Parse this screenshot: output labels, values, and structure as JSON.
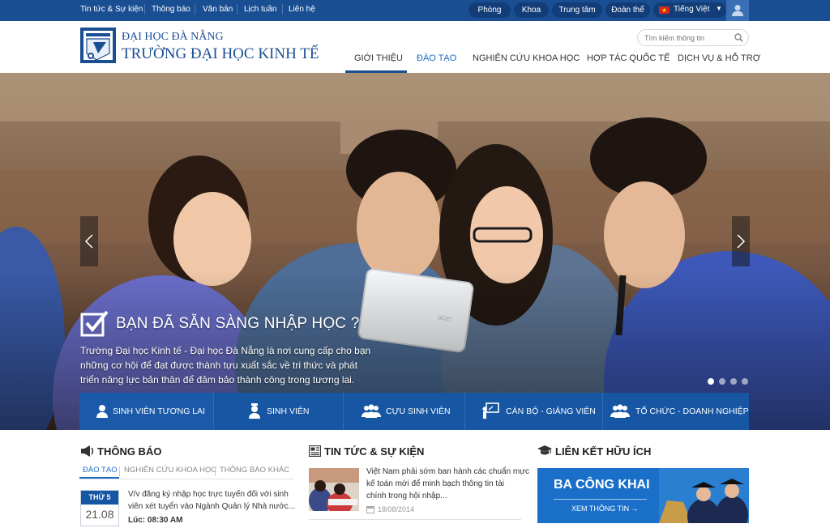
{
  "topbar": {
    "links": [
      "Tin tức & Sự kiện",
      "Thông báo",
      "Văn bản",
      "Lịch tuần",
      "Liên hệ"
    ],
    "pills": [
      "Phòng",
      "Khoa",
      "Trung tâm",
      "Đoàn thể"
    ],
    "language": "Tiếng Việt"
  },
  "header": {
    "university": "ĐẠI HỌC ĐÀ NẴNG",
    "school": "TRƯỜNG ĐẠI HỌC KINH TẾ",
    "search_placeholder": "Tìm kiếm thông tin",
    "nav": [
      "GIỚI THIỆU",
      "ĐÀO TẠO",
      "NGHIÊN CỨU KHOA HỌC",
      "HỢP TÁC QUỐC TẾ",
      "DỊCH VỤ & HỖ TRỢ"
    ]
  },
  "hero": {
    "heading": "BẠN ĐÃ SẴN SÀNG NHẬP HỌC ?",
    "text_lines": [
      "Trường Đại học Kinh tế - Đại học Đà Nẵng là nơi cung cấp cho bạn",
      "những cơ hội để đạt được thành tựu xuất sắc về tri thức và phát",
      "triển năng lực bản thân để đảm bảo thành công trong tương lai."
    ],
    "tablet_brand": "acer"
  },
  "tiles": [
    "SINH VIÊN TƯƠNG LAI",
    "SINH VIÊN",
    "CỰU SINH VIÊN",
    "CÁN BỘ - GIẢNG VIÊN",
    "TỔ CHỨC - DOANH NGHIỆP"
  ],
  "notices": {
    "title": "THÔNG BÁO",
    "tabs": [
      "ĐÀO TẠO",
      "NGHIÊN CỨU KHOA HỌC",
      "THÔNG BÁO KHÁC"
    ],
    "weekday": "THỨ 5",
    "date": "21.08",
    "text_lines": [
      "V/v đăng ký nhập học trực tuyến đối với sinh",
      "viên xét tuyển vào Ngành Quản lý Nhà nước..."
    ],
    "time": "Lúc: 08:30 AM"
  },
  "news": {
    "title": "TIN TỨC & SỰ KIỆN",
    "text_lines": [
      "Việt Nam phải sớm ban hành các chuẩn mực",
      "kế toán mới để minh bạch thông tin tài",
      "chính trong hội nhập..."
    ],
    "date": "18/08/2014"
  },
  "links": {
    "title": "LIÊN KẾT HỮU ÍCH",
    "banner_title": "BA CÔNG KHAI",
    "banner_link": "XEM THÔNG TIN →"
  },
  "colors": {
    "topbar": "#1a4e93",
    "pill": "#123d78",
    "brand_blue": "#1656a3",
    "nav_active": "#1a6bc6",
    "banner": "#1a70c8"
  },
  "icons": [
    "user-icon",
    "search-icon",
    "flag-vn-icon",
    "chevron-left-icon",
    "chevron-right-icon",
    "checkbox-icon",
    "megaphone-icon",
    "newspaper-icon",
    "graduation-cap-icon",
    "people-icon",
    "board-icon",
    "calendar-icon"
  ],
  "slider": {
    "dot_count": 4,
    "active_dot": 1
  }
}
